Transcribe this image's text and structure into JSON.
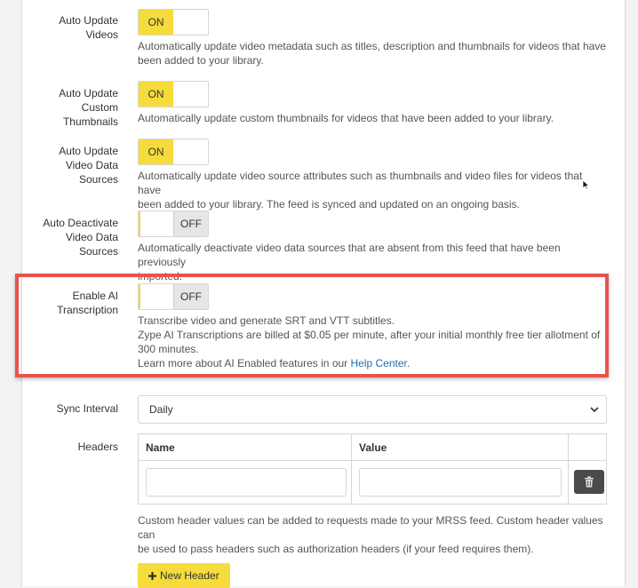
{
  "settings": [
    {
      "label_lines": [
        "Auto Update",
        "Videos"
      ],
      "state": "ON",
      "desc_lines": [
        "Automatically update video metadata such as titles, description and thumbnails for videos that have",
        "been added to your library."
      ]
    },
    {
      "label_lines": [
        "Auto Update",
        "Custom",
        "Thumbnails"
      ],
      "state": "ON",
      "desc_lines": [
        "Automatically update custom thumbnails for videos that have been added to your library."
      ]
    },
    {
      "label_lines": [
        "Auto Update",
        "Video Data",
        "Sources"
      ],
      "state": "ON",
      "desc_lines": [
        "Automatically update video source attributes such as thumbnails and video files for videos that have",
        "been added to your library. The feed is synced and updated on an ongoing basis."
      ]
    },
    {
      "label_lines": [
        "Auto Deactivate",
        "Video Data",
        "Sources"
      ],
      "state": "OFF",
      "desc_lines": [
        "Automatically deactivate video data sources that are absent from this feed that have been previously",
        "imported."
      ]
    },
    {
      "label_lines": [
        "Enable AI",
        "Transcription"
      ],
      "state": "OFF",
      "desc_lines": [
        "Transcribe video and generate SRT and VTT subtitles.",
        "Zype AI Transcriptions are billed at $0.05 per minute, after your initial monthly free tier allotment of",
        "300 minutes."
      ],
      "learn_more_prefix": "Learn more about AI Enabled features in our ",
      "learn_more_link": "Help Center",
      "learn_more_suffix": "."
    }
  ],
  "sync_interval": {
    "label": "Sync Interval",
    "selected": "Daily"
  },
  "headers": {
    "label": "Headers",
    "col_name": "Name",
    "col_value": "Value",
    "name_value": "",
    "value_value": "",
    "desc_lines": [
      "Custom header values can be added to requests made to your MRSS feed. Custom header values can",
      "be used to pass headers such as authorization headers (if your feed requires them)."
    ],
    "new_header_label": "New Header"
  },
  "colors": {
    "accent_yellow": "#f5dc3c",
    "highlight_red": "#e9534f",
    "link_blue": "#1f6fb2"
  },
  "icons": [
    "plus-icon",
    "trash-icon",
    "chevron-down-icon",
    "mouse-cursor-icon"
  ]
}
